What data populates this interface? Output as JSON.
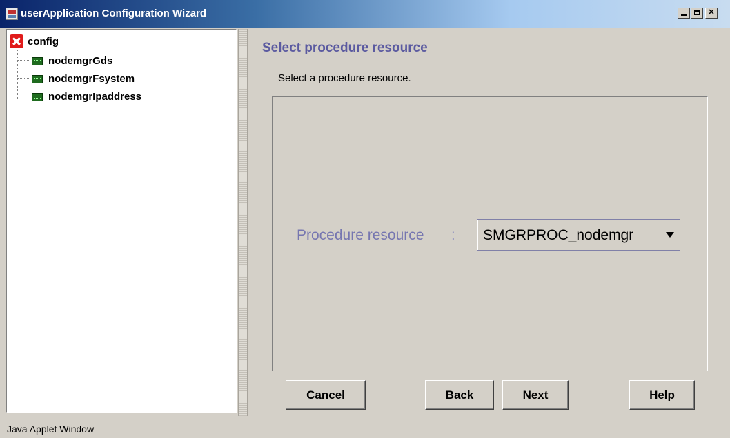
{
  "window": {
    "title": "userApplication Configuration Wizard"
  },
  "tree": {
    "root": "config",
    "children": [
      "nodemgrGds",
      "nodemgrFsystem",
      "nodemgrIpaddress"
    ]
  },
  "wizard": {
    "heading": "Select procedure resource",
    "instruction": "Select a procedure resource.",
    "field_label": "Procedure resource",
    "field_separator": ":",
    "field_value": "SMGRPROC_nodemgr"
  },
  "buttons": {
    "cancel": "Cancel",
    "back": "Back",
    "next": "Next",
    "help": "Help"
  },
  "status": {
    "text": "Java Applet Window"
  },
  "colors": {
    "heading": "#5b5aa0",
    "field_label": "#7676b0",
    "title_bar_start": "#0a246a"
  }
}
